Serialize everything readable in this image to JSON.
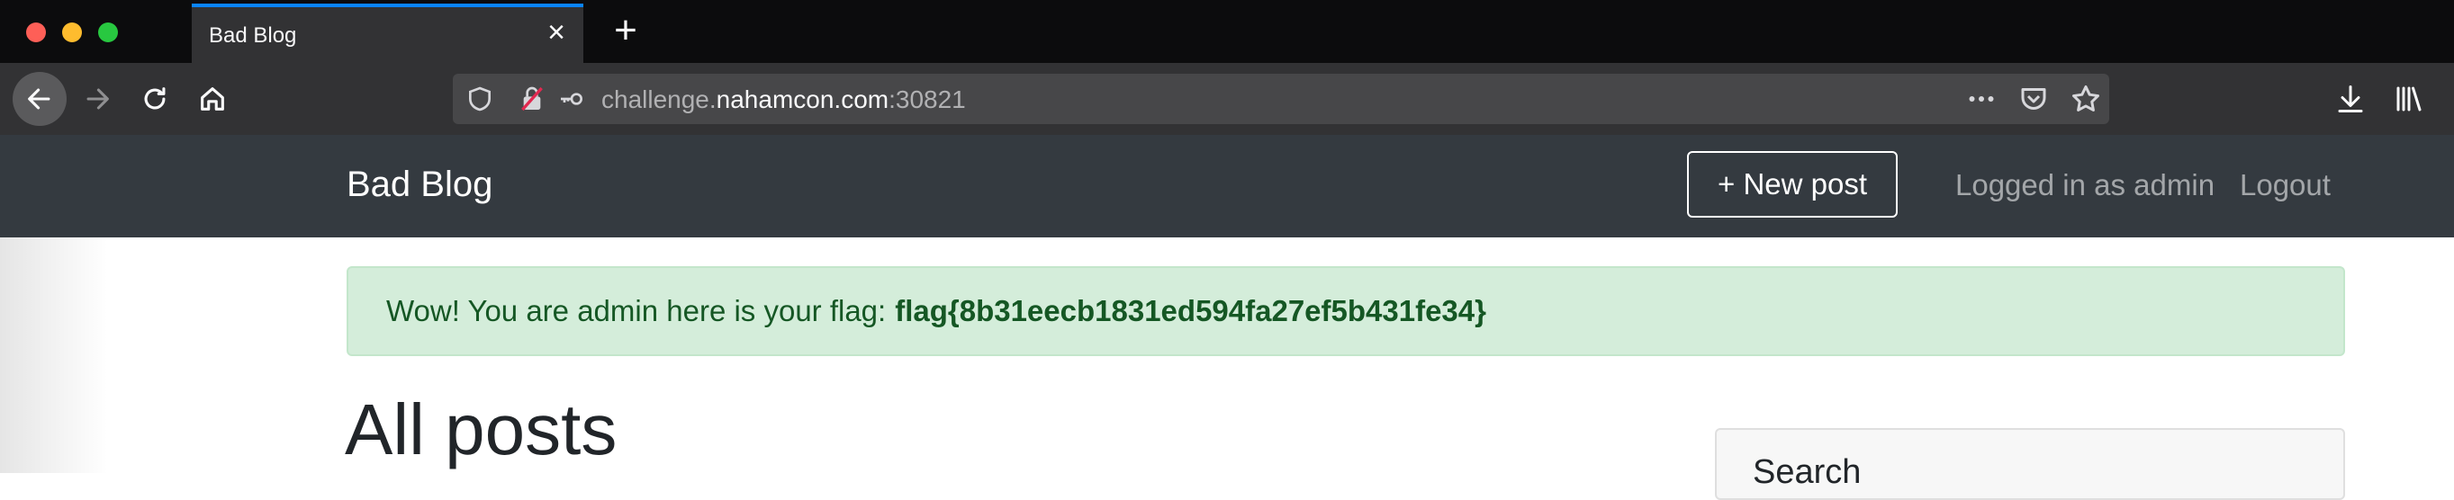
{
  "browser": {
    "tab_title": "Bad Blog",
    "url": {
      "prefix": "challenge.",
      "host": "nahamcon.com",
      "port": ":30821"
    }
  },
  "navbar": {
    "brand": "Bad Blog",
    "new_post_label": "+ New post",
    "logged_in_label": "Logged in as admin",
    "logout_label": "Logout"
  },
  "alert": {
    "message": "Wow! You are admin here is your flag:",
    "flag": "flag{8b31eecb1831ed594fa27ef5b431fe34}"
  },
  "main": {
    "heading": "All posts"
  },
  "sidebar": {
    "search_title": "Search"
  },
  "icons": {
    "back": "arrow-left-icon",
    "forward": "arrow-right-icon",
    "reload": "reload-icon",
    "home": "home-icon",
    "shield": "shield-icon",
    "lock": "insecure-lock-icon",
    "key": "key-icon",
    "more": "more-icon",
    "pocket": "pocket-icon",
    "bookmark": "star-icon",
    "download": "download-icon",
    "library": "library-icon"
  }
}
